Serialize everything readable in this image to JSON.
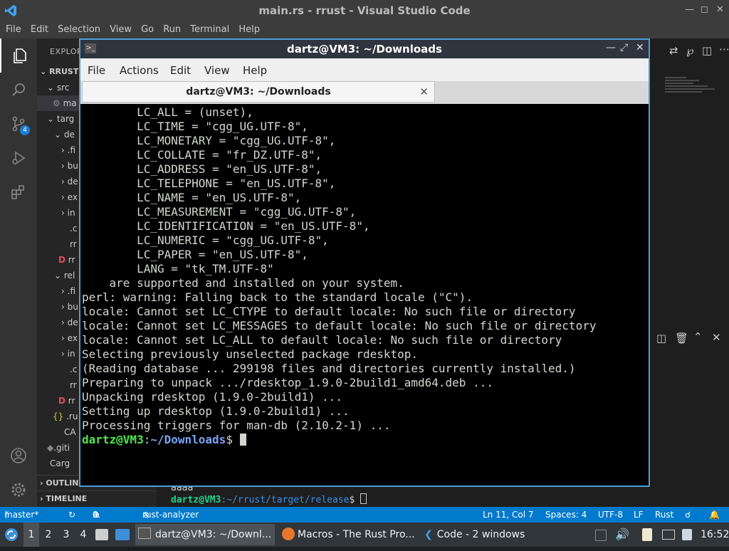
{
  "vscode": {
    "window_title": "main.rs - rrust - Visual Studio Code",
    "menu": [
      "File",
      "Edit",
      "Selection",
      "View",
      "Go",
      "Run",
      "Terminal",
      "Help"
    ],
    "activity_badge": "4",
    "explorer_header": "EXPLOR",
    "tree": [
      {
        "label": "RRUST",
        "bold": true
      },
      {
        "label": "src"
      },
      {
        "label": "ma"
      },
      {
        "label": "targ"
      },
      {
        "label": "de"
      },
      {
        "label": ".fi"
      },
      {
        "label": "bu"
      },
      {
        "label": "de"
      },
      {
        "label": "ex"
      },
      {
        "label": "in"
      },
      {
        "label": ".c"
      },
      {
        "label": "rr"
      },
      {
        "label": "rr"
      },
      {
        "label": "rel"
      },
      {
        "label": ".fi"
      },
      {
        "label": "bu"
      },
      {
        "label": "de"
      },
      {
        "label": "ex"
      },
      {
        "label": "in"
      },
      {
        "label": ".c"
      },
      {
        "label": "rr"
      },
      {
        "label": "rr"
      },
      {
        "label": ".ru"
      },
      {
        "label": "CA"
      },
      {
        "label": ".giti"
      },
      {
        "label": "Carg"
      }
    ],
    "outline_label": "OUTLINE",
    "timeline_label": "TIMELINE",
    "panel_terminal": {
      "line1": "aaaa",
      "prompt_user": "dartz@VM3",
      "prompt_path": ":~/rrust/target/release",
      "prompt_symbol": "$"
    },
    "statusbar": {
      "branch": "master*",
      "errors": "0",
      "warnings": "0",
      "rust_analyzer": "rust-analyzer",
      "position": "Ln 11, Col 7",
      "spaces": "Spaces: 4",
      "encoding": "UTF-8",
      "eol": "LF",
      "language": "Rust"
    }
  },
  "terminal": {
    "window_title": "dartz@VM3: ~/Downloads",
    "menu": [
      "File",
      "Actions",
      "Edit",
      "View",
      "Help"
    ],
    "tab_title": "dartz@VM3: ~/Downloads",
    "lines": [
      "        LC_ALL = (unset),",
      "        LC_TIME = \"cgg_UG.UTF-8\",",
      "        LC_MONETARY = \"cgg_UG.UTF-8\",",
      "        LC_COLLATE = \"fr_DZ.UTF-8\",",
      "        LC_ADDRESS = \"en_US.UTF-8\",",
      "        LC_TELEPHONE = \"en_US.UTF-8\",",
      "        LC_NAME = \"en_US.UTF-8\",",
      "        LC_MEASUREMENT = \"cgg_UG.UTF-8\",",
      "        LC_IDENTIFICATION = \"en_US.UTF-8\",",
      "        LC_NUMERIC = \"cgg_UG.UTF-8\",",
      "        LC_PAPER = \"en_US.UTF-8\",",
      "        LANG = \"tk_TM.UTF-8\"",
      "    are supported and installed on your system.",
      "perl: warning: Falling back to the standard locale (\"C\").",
      "locale: Cannot set LC_CTYPE to default locale: No such file or directory",
      "locale: Cannot set LC_MESSAGES to default locale: No such file or directory",
      "locale: Cannot set LC_ALL to default locale: No such file or directory",
      "Selecting previously unselected package rdesktop.",
      "(Reading database ... 299198 files and directories currently installed.)",
      "Preparing to unpack .../rdesktop_1.9.0-2build1_amd64.deb ...",
      "Unpacking rdesktop (1.9.0-2build1) ...",
      "Setting up rdesktop (1.9.0-2build1) ...",
      "Processing triggers for man-db (2.10.2-1) ..."
    ],
    "prompt_user": "dartz@VM3",
    "prompt_colon": ":",
    "prompt_path": "~/Downloads",
    "prompt_symbol": "$ "
  },
  "taskbar": {
    "workspaces": [
      "1",
      "2",
      "3",
      "4"
    ],
    "tasks": [
      {
        "label": "dartz@VM3: ~/Downl..."
      },
      {
        "label": "Macros - The Rust Pro..."
      },
      {
        "label": "Code - 2 windows"
      }
    ],
    "clock": "16:52"
  },
  "colors": {
    "accent": "#007acc",
    "prompt_green": "#4ee94e",
    "prompt_blue": "#7aa3f5",
    "rust_analyzer_bg": "#c72e0f"
  }
}
